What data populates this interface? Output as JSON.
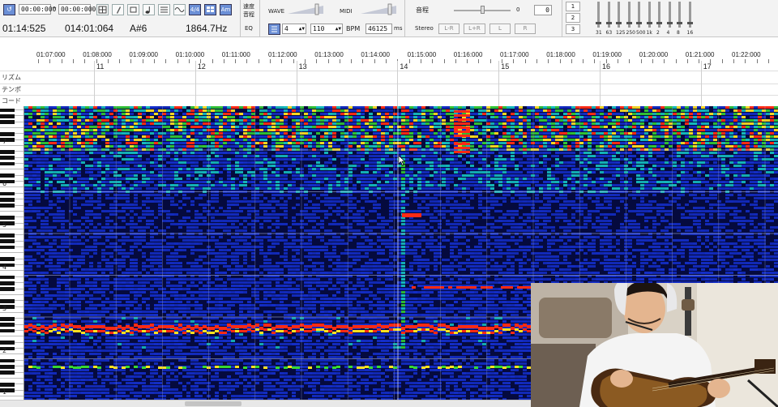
{
  "toolbar": {
    "range_start": "00:00:000",
    "range_sep": "~",
    "range_end": "00:00:000",
    "speed_label_top": "速度",
    "speed_label_bottom": "音程",
    "eq_label": "EQ",
    "wave_label": "WAVE",
    "midi_label": "MIDI",
    "beat_value": "4",
    "bpm_number": "110",
    "bpm_label": "BPM",
    "ms_value": "46125",
    "ms_label": "ms",
    "pitch_label": "音程",
    "pitch_value_left": "0",
    "pitch_value_right": "0",
    "stereo_label": "Stereo",
    "stereo_buttons": [
      "L-R",
      "L+R",
      "L",
      "R"
    ],
    "track_numbers": [
      "1",
      "2",
      "3"
    ],
    "eq_band_labels": [
      "31",
      "63",
      "125",
      "250",
      "500",
      "1k",
      "2",
      "4",
      "8",
      "16"
    ],
    "button_labels": {
      "loop": "↺",
      "beat_snap": "4/4",
      "am": "Am"
    }
  },
  "readouts": {
    "current_time": "01:14:525",
    "measure_pos": "014:01:064",
    "note": "A#6",
    "frequency": "1864.7Hz"
  },
  "timeline": {
    "time_labels": [
      "01:07:000",
      "01:08:000",
      "01:09:000",
      "01:10:000",
      "01:11:000",
      "01:12:000",
      "01:13:000",
      "01:14:000",
      "01:15:000",
      "01:16:000",
      "01:17:000",
      "01:18:000",
      "01:19:000",
      "01:20:000",
      "01:21:000",
      "01:22:000"
    ],
    "measures": [
      "11",
      "12",
      "13",
      "14",
      "15",
      "16",
      "17"
    ],
    "rows": [
      "リズム",
      "テンポ",
      "コード"
    ]
  },
  "piano": {
    "octave_labels": [
      "7",
      "6",
      "5",
      "4",
      "3",
      "2",
      "1"
    ]
  },
  "colors": {
    "spectrogram_bg": "#050a3e",
    "heat_low": "#1a3cff",
    "heat_mid": "#17e0d8",
    "heat_green": "#36d832",
    "heat_high": "#ffe020",
    "heat_peak": "#ff2a14"
  }
}
